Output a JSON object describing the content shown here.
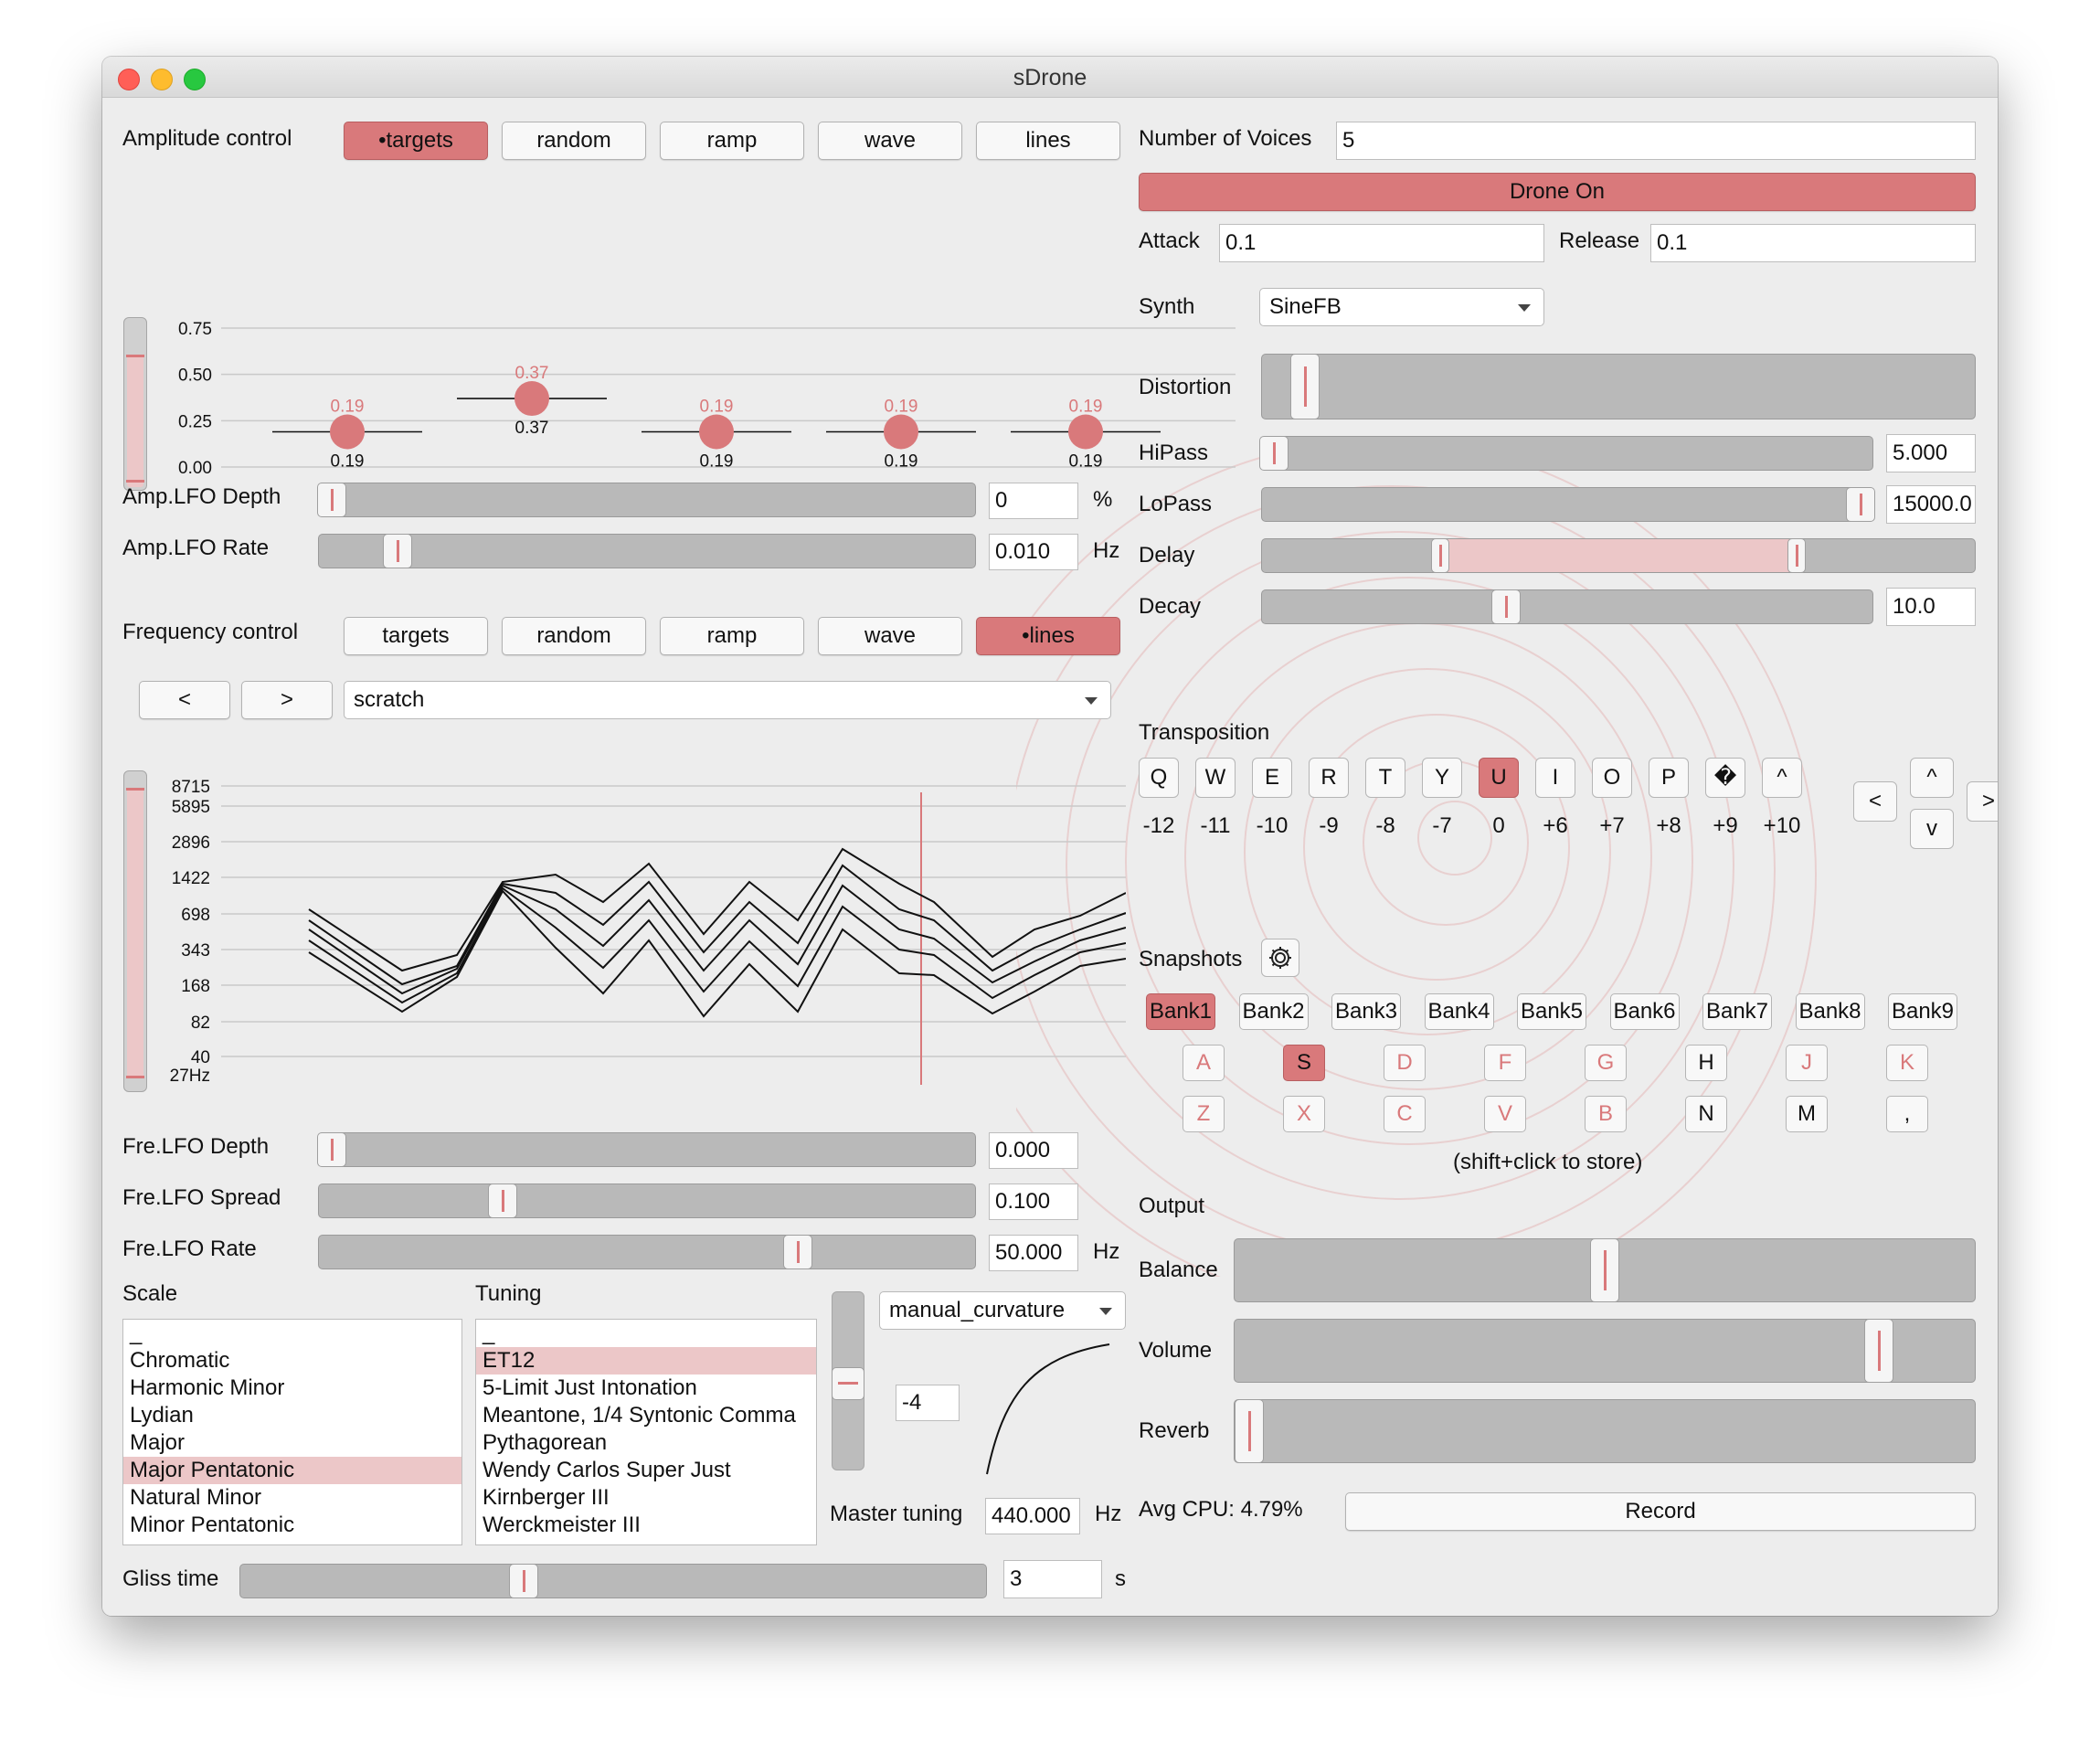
{
  "window": {
    "title": "sDrone"
  },
  "amplitude": {
    "label": "Amplitude control",
    "modes": [
      "•targets",
      "random",
      "ramp",
      "wave",
      "lines"
    ],
    "active_mode": 0,
    "axis_ticks": [
      "0.75",
      "0.50",
      "0.25",
      "0.00"
    ],
    "targets": [
      {
        "value": "0.19",
        "label": "0.19"
      },
      {
        "value": "0.37",
        "label": "0.37"
      },
      {
        "value": "0.19",
        "label": "0.19"
      },
      {
        "value": "0.19",
        "label": "0.19"
      },
      {
        "value": "0.19",
        "label": "0.19"
      }
    ]
  },
  "amp_lfo_depth": {
    "label": "Amp.LFO Depth",
    "value": "0",
    "unit": "%",
    "level": 0.02
  },
  "amp_lfo_rate": {
    "label": "Amp.LFO Rate",
    "value": "0.010",
    "unit": "Hz",
    "level": 0.12
  },
  "frequency": {
    "label": "Frequency control",
    "modes": [
      "targets",
      "random",
      "ramp",
      "wave",
      "•lines"
    ],
    "active_mode": 4,
    "prev_label": "<",
    "next_label": ">",
    "preset": "scratch",
    "axis_ticks": [
      "8715",
      "5895",
      "2896",
      "1422",
      "698",
      "343",
      "168",
      "82",
      "40",
      "27Hz"
    ]
  },
  "fre_lfo_depth": {
    "label": "Fre.LFO Depth",
    "value": "0.000",
    "level": 0.02
  },
  "fre_lfo_spread": {
    "label": "Fre.LFO Spread",
    "value": "0.100",
    "level": 0.28
  },
  "fre_lfo_rate": {
    "label": "Fre.LFO Rate",
    "value": "50.000",
    "unit": "Hz",
    "level": 0.73
  },
  "scale": {
    "label": "Scale",
    "items": [
      "_",
      "Chromatic",
      "Harmonic Minor",
      "Lydian",
      "Major",
      "Major Pentatonic",
      "Natural Minor",
      "Minor Pentatonic"
    ],
    "selected": 5
  },
  "tuning": {
    "label": "Tuning",
    "items": [
      "_",
      "ET12",
      "5-Limit Just Intonation",
      "Meantone, 1/4 Syntonic Comma",
      "Pythagorean",
      "Wendy Carlos Super Just",
      "Kirnberger III",
      "Werckmeister III"
    ],
    "selected": 1
  },
  "curvature": {
    "mode": "manual_curvature",
    "value": "-4"
  },
  "master_tuning": {
    "label": "Master tuning",
    "value": "440.000",
    "unit": "Hz"
  },
  "gliss": {
    "label": "Gliss time",
    "value": "3",
    "unit": "s",
    "level": 0.38
  },
  "voices": {
    "label": "Number of Voices",
    "value": "5"
  },
  "drone_button": "Drone On",
  "attack": {
    "label": "Attack",
    "value": "0.1"
  },
  "release": {
    "label": "Release",
    "value": "0.1"
  },
  "synth": {
    "label": "Synth",
    "value": "SineFB"
  },
  "distortion": {
    "label": "Distortion",
    "level": 0.06
  },
  "hipass": {
    "label": "HiPass",
    "value": "5.000",
    "level": 0.02
  },
  "lopass": {
    "label": "LoPass",
    "value": "15000.0",
    "level": 0.98
  },
  "delay": {
    "label": "Delay",
    "range": [
      0.25,
      0.75
    ]
  },
  "decay": {
    "label": "Decay",
    "value": "10.0",
    "level": 0.4
  },
  "transposition": {
    "label": "Transposition",
    "keys": [
      "Q",
      "W",
      "E",
      "R",
      "T",
      "Y",
      "U",
      "I",
      "O",
      "P",
      "�",
      "^"
    ],
    "values": [
      "-12",
      "-11",
      "-10",
      "-9",
      "-8",
      "-7",
      "0",
      "+6",
      "+7",
      "+8",
      "+9",
      "+10"
    ],
    "active": 6,
    "nav": {
      "left": "<",
      "up": "^",
      "down": "v",
      "right": ">"
    }
  },
  "snapshots": {
    "label": "Snapshots",
    "banks": [
      "Bank1",
      "Bank2",
      "Bank3",
      "Bank4",
      "Bank5",
      "Bank6",
      "Bank7",
      "Bank8",
      "Bank9"
    ],
    "active_bank": 0,
    "row1": [
      "A",
      "S",
      "D",
      "F",
      "G",
      "H",
      "J",
      "K"
    ],
    "row2": [
      "Z",
      "X",
      "C",
      "V",
      "B",
      "N",
      "M",
      ","
    ],
    "active_key": "S",
    "stored_keys": [
      "H",
      "N",
      "M",
      ","
    ],
    "hint": "(shift+click to store)"
  },
  "output": {
    "label": "Output",
    "balance": {
      "label": "Balance",
      "level": 0.5
    },
    "volume": {
      "label": "Volume",
      "level": 0.87
    },
    "reverb": {
      "label": "Reverb",
      "level": 0.02
    }
  },
  "cpu": {
    "label": "Avg CPU: 4.79%"
  },
  "record_button": "Record",
  "colors": {
    "accent": "#d9797b",
    "accent_light": "#ecc7c8",
    "window_bg": "#ededed"
  }
}
